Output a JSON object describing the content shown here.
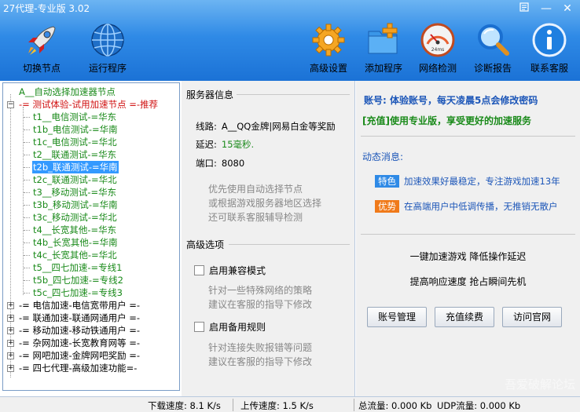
{
  "window": {
    "title": "27代理-专业版 3.02"
  },
  "toolbar": {
    "switch_node": "切换节点",
    "run_program": "运行程序",
    "advanced_settings": "高级设置",
    "add_program": "添加程序",
    "network_check": "网络检测",
    "diagnose_report": "诊断报告",
    "contact_support": "联系客服",
    "gauge_text": "24ms"
  },
  "tree": {
    "auto_node": "A__自动选择加速器节点",
    "trial_group": "-= 测试体验-试用加速节点 =-推荐",
    "nodes": [
      "t1__电信测试-=华东",
      "t1b_电信测试-=华南",
      "t1c_电信测试-=华北",
      "t2__联通测试-=华东",
      "t2b_联通测试-=华南",
      "t2c_联通测试-=华北",
      "t3__移动测试-=华东",
      "t3b_移动测试-=华南",
      "t3c_移动测试-=华北",
      "t4__长宽其他-=华东",
      "t4b_长宽其他-=华南",
      "t4c_长宽其他-=华北",
      "t5__四七加速-=专线1",
      "t5b_四七加速-=专线2",
      "t5c_四七加速-=专线3"
    ],
    "groups": [
      "-= 电信加速-电信宽带用户 =-",
      "-= 联通加速-联通网通用户 =-",
      "-= 移动加速-移动铁通用户 =-",
      "-= 杂网加速-长宽教育网等 =-",
      "-= 网吧加速-金牌网吧奖励 =-",
      "-= 四七代理-高级加速功能=-"
    ]
  },
  "server": {
    "section_title": "服务器信息",
    "route_label": "线路:",
    "route_value": "A__QQ金牌|网易白金等奖励",
    "latency_label": "延迟:",
    "latency_value": "15毫秒.",
    "port_label": "端口:",
    "port_value": "8080",
    "hint_lines": [
      "优先使用自动选择节点",
      "或根据游戏服务器地区选择",
      "还可联系客服辅导检测"
    ]
  },
  "advanced": {
    "section_title": "高级选项",
    "compat_label": "启用兼容模式",
    "compat_hint": [
      "针对一些特殊网络的策略",
      "建议在客服的指导下修改"
    ],
    "backup_label": "启用备用规则",
    "backup_hint": [
      "针对连接失败报错等问题",
      "建议在客服的指导下修改"
    ]
  },
  "account": {
    "line": "账号: 体验账号，每天凌晨5点会修改密码",
    "vip_line": "[充值]使用专业版，享受更好的加速服务",
    "dynamic_title": "动态消息:",
    "news": [
      {
        "tag": "特色",
        "text": "加速效果好最稳定，专注游戏加速13年"
      },
      {
        "tag": "优势",
        "text": "在高端用户中低调传播，无推销无散户"
      }
    ],
    "slogan1": "一键加速游戏  降低操作延迟",
    "slogan2": "提高响应速度  抢占瞬间先机",
    "buttons": {
      "account_manage": "账号管理",
      "recharge": "充值续费",
      "visit_site": "访问官网"
    }
  },
  "status": {
    "download": "下载速度: 8.1 K/s",
    "upload": "上传速度: 1.5 K/s",
    "total_traffic": "总流量: 0.000 Kb",
    "udp_traffic": "UDP流量: 0.000 Kb"
  },
  "watermark": "吾爱破解论坛",
  "colors": {
    "title_blue": "#2f8ae6",
    "node_green": "#1a8a1a",
    "node_red": "#d01010",
    "selection": "#3399ff",
    "tag_orange": "#f07a1a",
    "text_blue": "#1c56b8"
  }
}
